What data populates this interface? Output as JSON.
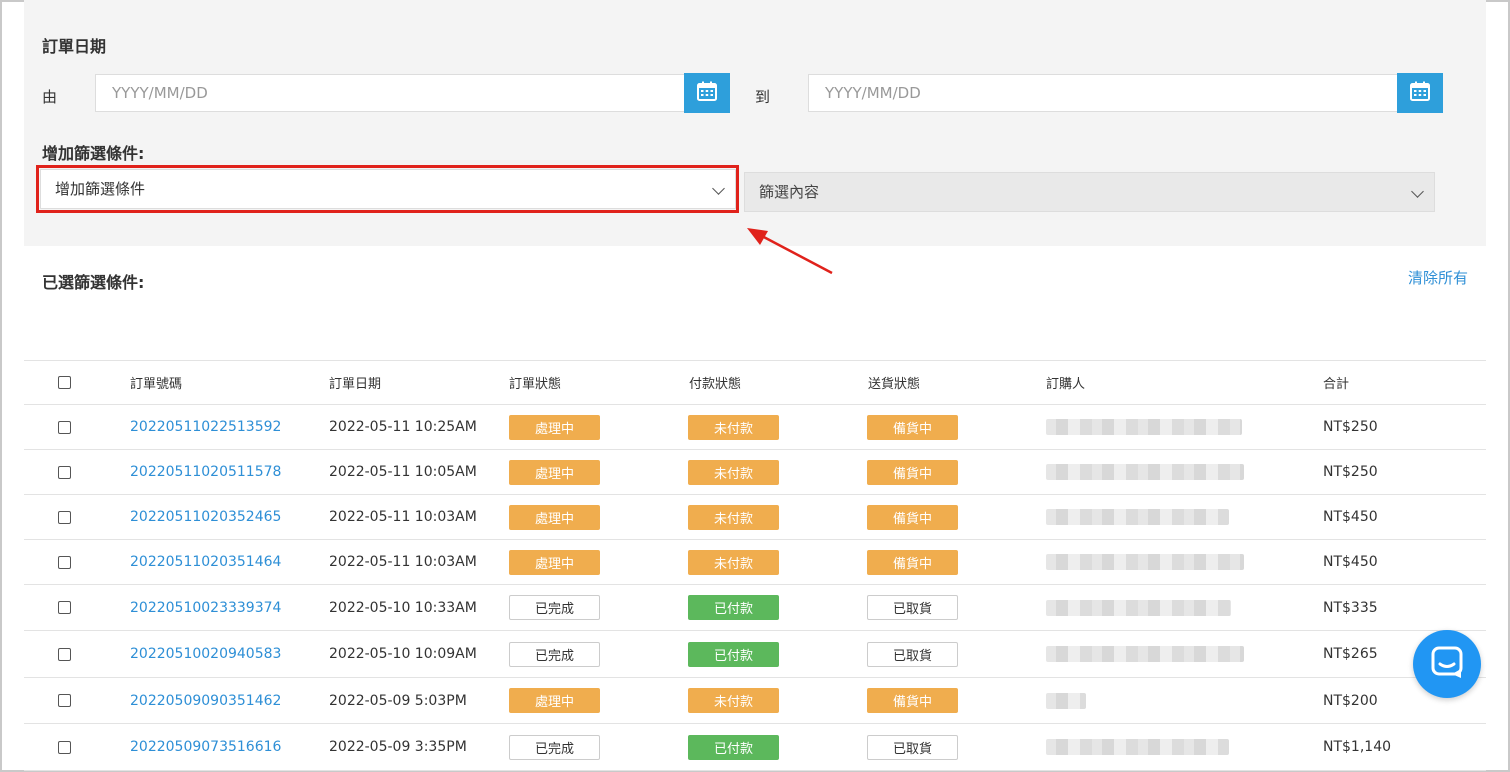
{
  "filters": {
    "date_section_title": "訂單日期",
    "from_label": "由",
    "to_label": "到",
    "from_placeholder": "YYYY/MM/DD",
    "to_placeholder": "YYYY/MM/DD",
    "add_filter_title": "增加篩選條件:",
    "add_filter_select_value": "增加篩選條件",
    "filter_content_select_value": "篩選內容",
    "selected_filters_title": "已選篩選條件:",
    "clear_all": "清除所有"
  },
  "table": {
    "columns": [
      "訂單號碼",
      "訂單日期",
      "訂單狀態",
      "付款狀態",
      "送貨狀態",
      "訂購人",
      "合計"
    ],
    "rows": [
      {
        "order_no": "20220511022513592",
        "date": "2022-05-11 10:25AM",
        "order_status": "處理中",
        "payment_status": "未付款",
        "delivery_status": "備貨中",
        "total": "NT$250"
      },
      {
        "order_no": "20220511020511578",
        "date": "2022-05-11 10:05AM",
        "order_status": "處理中",
        "payment_status": "未付款",
        "delivery_status": "備貨中",
        "total": "NT$250"
      },
      {
        "order_no": "20220511020352465",
        "date": "2022-05-11 10:03AM",
        "order_status": "處理中",
        "payment_status": "未付款",
        "delivery_status": "備貨中",
        "total": "NT$450"
      },
      {
        "order_no": "20220511020351464",
        "date": "2022-05-11 10:03AM",
        "order_status": "處理中",
        "payment_status": "未付款",
        "delivery_status": "備貨中",
        "total": "NT$450"
      },
      {
        "order_no": "20220510023339374",
        "date": "2022-05-10 10:33AM",
        "order_status": "已完成",
        "payment_status": "已付款",
        "delivery_status": "已取貨",
        "total": "NT$335"
      },
      {
        "order_no": "20220510020940583",
        "date": "2022-05-10 10:09AM",
        "order_status": "已完成",
        "payment_status": "已付款",
        "delivery_status": "已取貨",
        "total": "NT$265"
      },
      {
        "order_no": "20220509090351462",
        "date": "2022-05-09 5:03PM",
        "order_status": "處理中",
        "payment_status": "未付款",
        "delivery_status": "備貨中",
        "total": "NT$200"
      },
      {
        "order_no": "20220509073516616",
        "date": "2022-05-09 3:35PM",
        "order_status": "已完成",
        "payment_status": "已付款",
        "delivery_status": "已取貨",
        "total": "NT$1,140"
      }
    ]
  },
  "colors": {
    "accent_blue": "#2e9fdb",
    "link_blue": "#2e8fd6",
    "badge_orange": "#f0ad4e",
    "badge_green": "#5cb85c",
    "highlight_red": "#e0221b",
    "chat_blue": "#2196f3"
  },
  "icons": {
    "calendar": "calendar-icon",
    "chevron": "chevron-down-icon",
    "chat": "chat-icon",
    "annotation_arrow": "arrow-icon"
  }
}
